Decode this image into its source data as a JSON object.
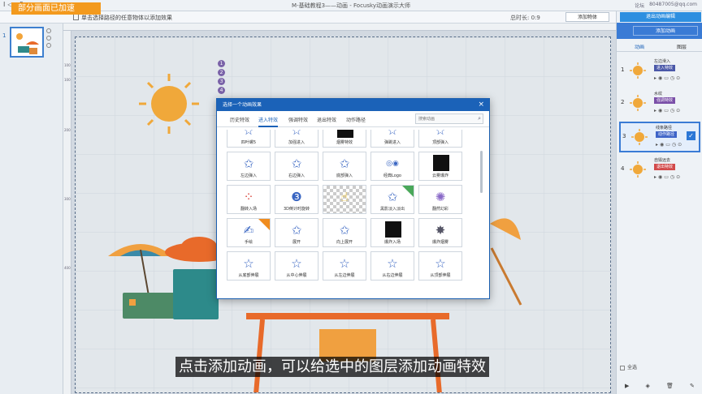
{
  "titlebar": {
    "title": "M-基础教程3——动画 - Focusky动画演示大师",
    "icons": "I◁ 5 ▷",
    "right_links": [
      "论坛",
      "80487005@qq.com"
    ]
  },
  "overlay": {
    "speed_badge": "部分画面已加速"
  },
  "toolbar": {
    "hint": "单击选择路径的任意物体以添加效果",
    "total_time_label": "总时长: 0:9",
    "add_object_label": "添加物体"
  },
  "thumbnails": {
    "items": [
      {
        "number": "1"
      }
    ]
  },
  "canvas": {
    "ruler_ticks": [
      "100",
      "100",
      "200",
      "300",
      "400"
    ],
    "sequence_badges": [
      "1",
      "2",
      "3",
      "4"
    ]
  },
  "dialog": {
    "title": "选择一个动画效果",
    "close": "×",
    "tabs": [
      {
        "label": "历史特效"
      },
      {
        "label": "进入特效"
      },
      {
        "label": "强调特效"
      },
      {
        "label": "退出特效"
      },
      {
        "label": "动作路径"
      }
    ],
    "search_placeholder": "搜索动画",
    "rows": [
      [
        "四叶螺5",
        "加强进入",
        "烟雾特效",
        "弹跳进入",
        "顶部弹入"
      ],
      [
        "左边弹入",
        "右边弹入",
        "底部弹入",
        "经典Logo",
        "云雾爆炸"
      ],
      [
        "翻转入场",
        "3D倒计时旋转",
        "",
        "黑影淡入淡出",
        "翻然幻彩"
      ],
      [
        "手绘",
        "展开",
        "向上展开",
        "爆炸入场",
        "爆炸烟雾"
      ],
      [
        "从底部伸展",
        "从中心伸展",
        "从左边伸展",
        "从右边伸展",
        "从顶部伸展"
      ]
    ]
  },
  "panel": {
    "add_animation_label": "添加动画",
    "edit_animation_label": "退出动画编辑",
    "tabs": [
      {
        "label": "动画"
      },
      {
        "label": "图层"
      }
    ],
    "items": [
      {
        "number": "1",
        "name": "左边滑入",
        "effect": "进入特效",
        "effect_color": "#4a58a8"
      },
      {
        "number": "2",
        "name": "水纹",
        "effect": "强调特效",
        "effect_color": "#7a4fa8"
      },
      {
        "number": "3",
        "name": "线条路径",
        "effect": "动作路径",
        "effect_color": "#3e64c8"
      },
      {
        "number": "4",
        "name": "自毁远去",
        "effect": "退出特效",
        "effect_color": "#d24a4a"
      }
    ],
    "select_all": "全选"
  },
  "subtitle": {
    "text": "点击添加动画，可以给选中的图层添加动画特效"
  }
}
